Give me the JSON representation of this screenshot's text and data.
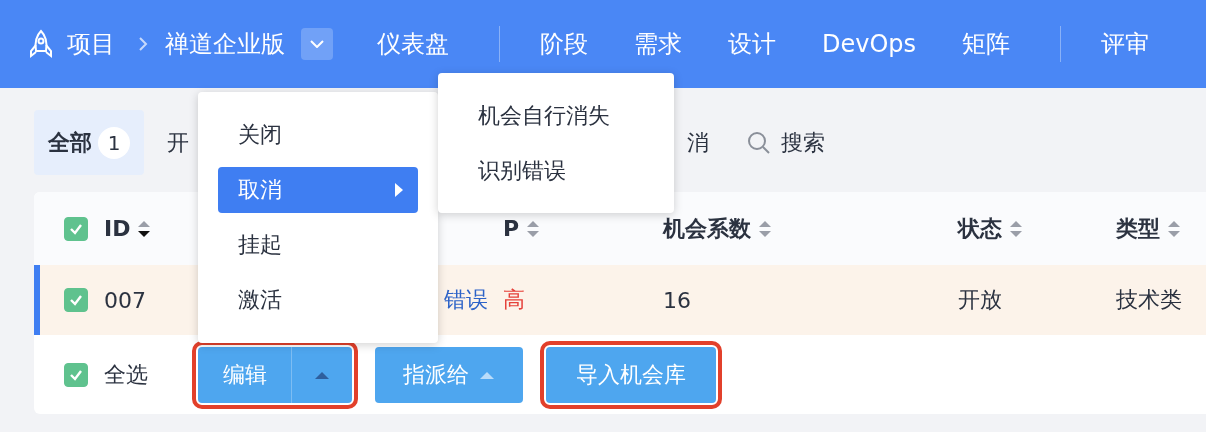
{
  "nav": {
    "breadcrumb": [
      "项目",
      "禅道企业版"
    ],
    "groups": [
      [
        "仪表盘"
      ],
      [
        "阶段",
        "需求",
        "设计",
        "DevOps",
        "矩阵"
      ],
      [
        "评审"
      ]
    ]
  },
  "filters": [
    {
      "label": "全部",
      "count": "1",
      "selected": true
    },
    {
      "label": "开",
      "selected": false
    },
    {
      "label": "消",
      "selected": false
    }
  ],
  "search": "搜索",
  "table": {
    "columns": [
      {
        "label": "ID",
        "sorted_desc": true
      },
      {
        "label": "P",
        "sorted_desc": false
      },
      {
        "label": "机会系数",
        "sorted_desc": false
      },
      {
        "label": "状态",
        "sorted_desc": false
      },
      {
        "label": "类型",
        "sorted_desc": false
      }
    ],
    "header_checked": true,
    "rows": [
      {
        "id": "007",
        "title": "错误",
        "priority": "高",
        "coefficient": "16",
        "status": "开放",
        "type": "技术类",
        "checked": true,
        "selected": true
      }
    ]
  },
  "footer": {
    "select_all": {
      "label": "全选",
      "checked": true
    },
    "buttons": [
      {
        "label": "编辑",
        "kind": "split",
        "highlighted": true
      },
      {
        "label": "指派给",
        "kind": "dropdown",
        "highlighted": false
      },
      {
        "label": "导入机会库",
        "kind": "plain",
        "highlighted": true
      }
    ]
  },
  "menu": {
    "items": [
      {
        "label": "关闭",
        "selected": false,
        "has_submenu": false
      },
      {
        "label": "取消",
        "selected": true,
        "has_submenu": true
      },
      {
        "label": "挂起",
        "selected": false,
        "has_submenu": false
      },
      {
        "label": "激活",
        "selected": false,
        "has_submenu": false
      }
    ]
  },
  "submenu": {
    "items": [
      "机会自行消失",
      "识别错误"
    ]
  }
}
